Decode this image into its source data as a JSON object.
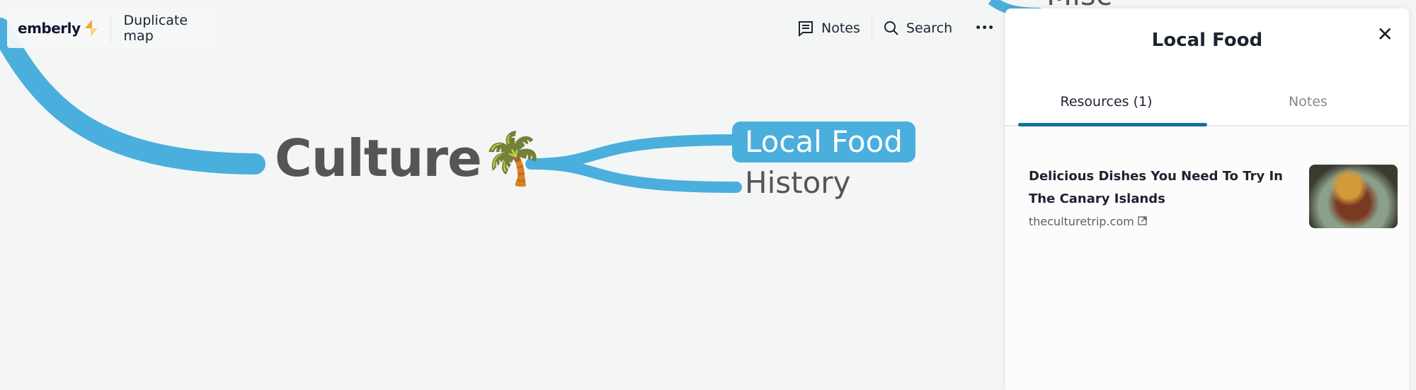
{
  "toolbar": {
    "logo_text": "emberly",
    "duplicate_label": "Duplicate map",
    "notes_label": "Notes",
    "search_label": "Search",
    "more_label": "•••"
  },
  "map": {
    "central": "Culture🌴",
    "branches": [
      "Local Food",
      "History"
    ],
    "partial_node": "Misc",
    "branch_color": "#4aafdc"
  },
  "panel": {
    "title": "Local Food",
    "close_label": "✕",
    "tabs": [
      {
        "label": "Resources (1)",
        "active": true
      },
      {
        "label": "Notes",
        "active": false
      }
    ],
    "resources": [
      {
        "title": "Delicious Dishes You Need To Try In The Canary Islands",
        "domain": "theculturetrip.com"
      }
    ],
    "accent": "#13709d"
  }
}
